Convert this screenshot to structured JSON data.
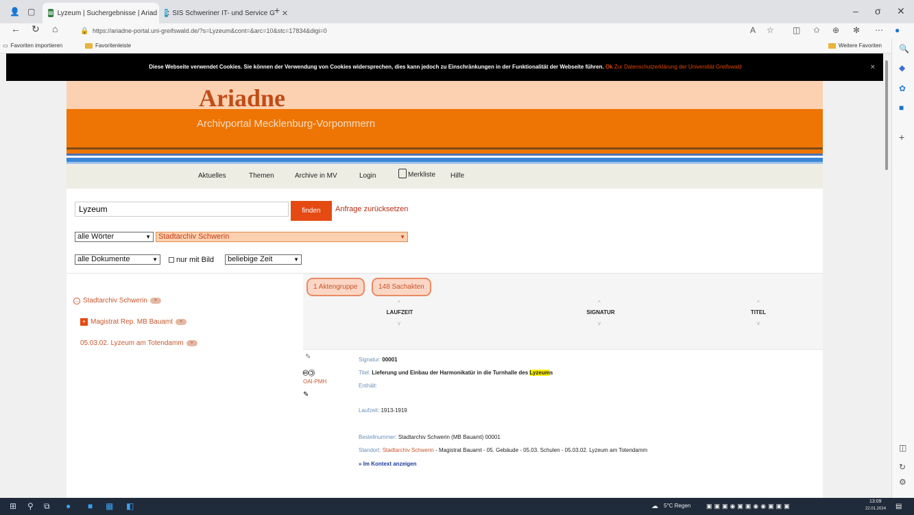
{
  "browser": {
    "tabs": [
      {
        "label": "Lyzeum | Suchergebnisse | Ariad",
        "active": true
      },
      {
        "label": "SIS Schweriner IT- und Service G",
        "active": false
      }
    ],
    "url": "https://ariadne-portal.uni-greifswald.de/?s=Lyzeum&cont=&arc=10&stc=17834&digi=0",
    "favorites": {
      "import": "Favoriten importieren",
      "bar": "Favoritenleiste",
      "more": "Weitere Favoriten"
    }
  },
  "cookie": {
    "text": "Diese Webseite verwendet Cookies. Sie können der Verwendung von Cookies widersprechen, dies kann jedoch zu Einschränkungen in der Funktionalität der Webseite führen.",
    "ok": "Ok",
    "privacy": "Zur Datenschutzerklärung der Universität Greifswald",
    "close": "×"
  },
  "header": {
    "logo": "Ariadne",
    "subtitle": "Archivportal Mecklenburg-Vorpommern"
  },
  "menu": [
    "Aktuelles",
    "Themen",
    "Archive in MV",
    "Login",
    "Merkliste",
    "Hilfe"
  ],
  "search": {
    "value": "Lyzeum",
    "button": "finden",
    "reset": "Anfrage zurücksetzen",
    "words": "alle Wörter",
    "archive": "Stadtarchiv Schwerin",
    "docs": "alle Dokumente",
    "image_only": "nur mit Bild",
    "time": "beliebige Zeit"
  },
  "counts": {
    "group": "1 Aktengruppe",
    "files": "148 Sachakten"
  },
  "tree": {
    "archive": "Stadtarchiv Schwerin",
    "level2": "Magistrat Rep. MB Bauamt",
    "level3": "05.03.02. Lyzeum am Totendamm"
  },
  "columns": {
    "laufzeit": "LAUFZEIT",
    "signatur": "SIGNATUR",
    "titel": "TITEL"
  },
  "result": {
    "signatur_label": "Signatur:",
    "signatur": "00001",
    "titel_label": "Titel:",
    "titel_pre": "Lieferung und Einbau der Harmonikatür in die Turnhalle des ",
    "titel_hl": "Lyzeum",
    "titel_post": "s",
    "enthaelt_label": "Enthält:",
    "laufzeit_label": "Laufzeit:",
    "laufzeit": "1913-1919",
    "bestell_label": "Bestellnummer:",
    "bestell": "Stadtarchiv Schwerin (MB Bauamt) 00001",
    "standort_label": "Standort:",
    "standort_link": "Stadtarchiv Schwerin",
    "standort_rest": "- Magistrat Bauamt - 05. Gebäude - 05.03. Schulen - 05.03.02. Lyzeum am Totendamm",
    "context": "» Im Kontext anzeigen",
    "oai": "OAI-PMH"
  },
  "taskbar": {
    "weather": "5°C Regen",
    "time": "13:09",
    "date": "22.01.2024"
  }
}
